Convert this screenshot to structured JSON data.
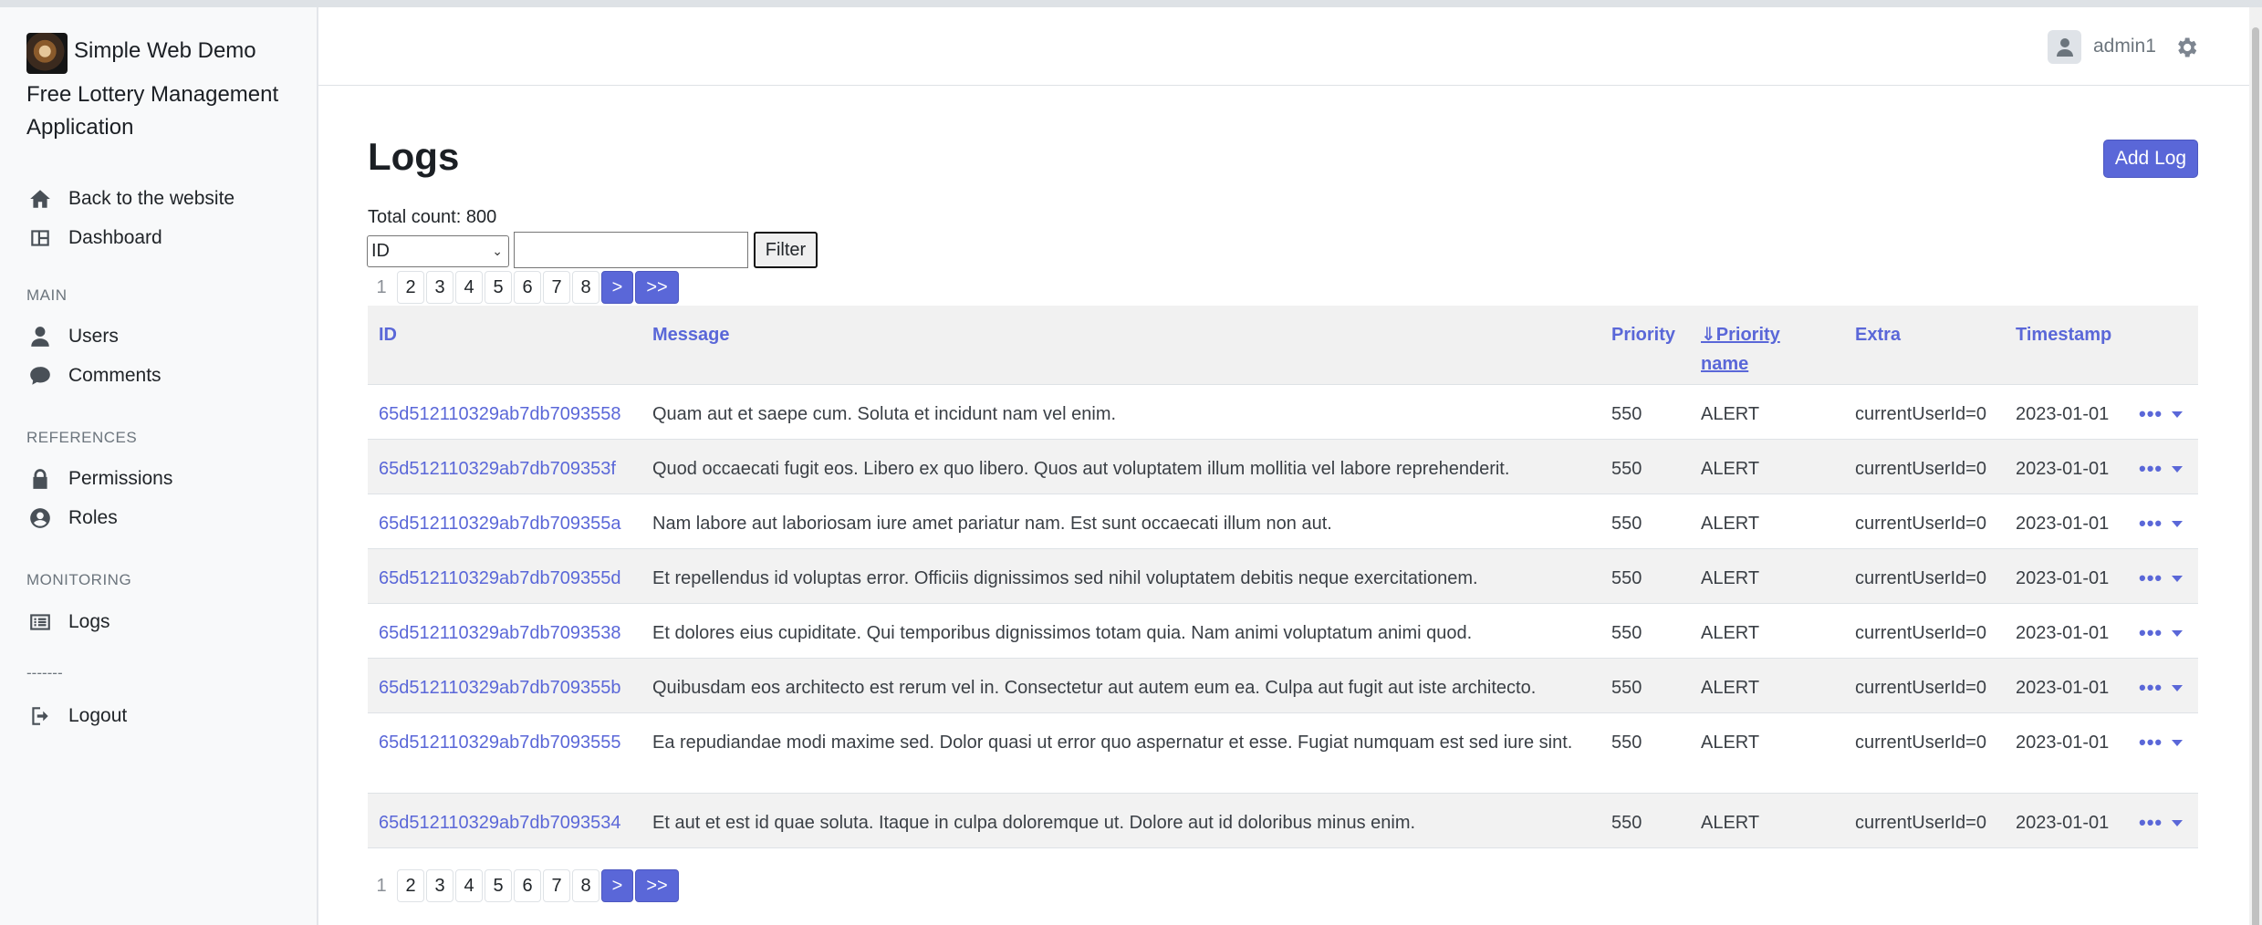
{
  "app": {
    "title": "Simple Web Demo",
    "subtitle": "Free Lottery Management Application"
  },
  "sidebar": {
    "top_items": [
      {
        "label": "Back to the website",
        "icon": "home-icon"
      },
      {
        "label": "Dashboard",
        "icon": "dashboard-icon"
      }
    ],
    "sections": [
      {
        "heading": "MAIN",
        "items": [
          {
            "label": "Users",
            "icon": "user-icon"
          },
          {
            "label": "Comments",
            "icon": "comment-icon"
          }
        ]
      },
      {
        "heading": "REFERENCES",
        "items": [
          {
            "label": "Permissions",
            "icon": "lock-icon"
          },
          {
            "label": "Roles",
            "icon": "user-circle-icon"
          }
        ]
      },
      {
        "heading": "MONITORING",
        "items": [
          {
            "label": "Logs",
            "icon": "list-icon"
          }
        ]
      }
    ],
    "separator": "-------",
    "logout": {
      "label": "Logout",
      "icon": "logout-icon"
    }
  },
  "header": {
    "username": "admin1"
  },
  "main": {
    "title": "Logs",
    "add_button": "Add Log",
    "total_count": "Total count: 800",
    "filter": {
      "selected_field": "ID",
      "input_value": "",
      "button_label": "Filter"
    },
    "pagination": {
      "current": "1",
      "pages": [
        "2",
        "3",
        "4",
        "5",
        "6",
        "7",
        "8"
      ],
      "next": ">",
      "last": ">>"
    },
    "table": {
      "columns": [
        "ID",
        "Message",
        "Priority",
        "⇓Priority name",
        "Extra",
        "Timestamp"
      ],
      "rows": [
        {
          "id": "65d512110329ab7db7093558",
          "message": "Quam aut et saepe cum. Soluta et incidunt nam vel enim.",
          "priority": "550",
          "priority_name": "ALERT",
          "extra": "currentUserId=0",
          "timestamp": "2023-01-01"
        },
        {
          "id": "65d512110329ab7db709353f",
          "message": "Quod occaecati fugit eos. Libero ex quo libero. Quos aut voluptatem illum mollitia vel labore reprehenderit.",
          "priority": "550",
          "priority_name": "ALERT",
          "extra": "currentUserId=0",
          "timestamp": "2023-01-01"
        },
        {
          "id": "65d512110329ab7db709355a",
          "message": "Nam labore aut laboriosam iure amet pariatur nam. Est sunt occaecati illum non aut.",
          "priority": "550",
          "priority_name": "ALERT",
          "extra": "currentUserId=0",
          "timestamp": "2023-01-01"
        },
        {
          "id": "65d512110329ab7db709355d",
          "message": "Et repellendus id voluptas error. Officiis dignissimos sed nihil voluptatem debitis neque exercitationem.",
          "priority": "550",
          "priority_name": "ALERT",
          "extra": "currentUserId=0",
          "timestamp": "2023-01-01"
        },
        {
          "id": "65d512110329ab7db7093538",
          "message": "Et dolores eius cupiditate. Qui temporibus dignissimos totam quia. Nam animi voluptatum animi quod.",
          "priority": "550",
          "priority_name": "ALERT",
          "extra": "currentUserId=0",
          "timestamp": "2023-01-01"
        },
        {
          "id": "65d512110329ab7db709355b",
          "message": "Quibusdam eos architecto est rerum vel in. Consectetur aut autem eum ea. Culpa aut fugit aut iste architecto.",
          "priority": "550",
          "priority_name": "ALERT",
          "extra": "currentUserId=0",
          "timestamp": "2023-01-01"
        },
        {
          "id": "65d512110329ab7db7093555",
          "message": "Ea repudiandae modi maxime sed. Dolor quasi ut error quo aspernatur et esse. Fugiat numquam est sed iure sint.",
          "priority": "550",
          "priority_name": "ALERT",
          "extra": "currentUserId=0",
          "timestamp": "2023-01-01"
        },
        {
          "id": "65d512110329ab7db7093534",
          "message": "Et aut et est id quae soluta. Itaque in culpa doloremque ut. Dolore aut id doloribus minus enim.",
          "priority": "550",
          "priority_name": "ALERT",
          "extra": "currentUserId=0",
          "timestamp": "2023-01-01"
        }
      ],
      "actions_icon": "more-dots-icon"
    }
  },
  "colors": {
    "accent": "#5a67d8",
    "sidebar_bg": "#f8f9fa",
    "row_alt": "#f2f2f2"
  }
}
